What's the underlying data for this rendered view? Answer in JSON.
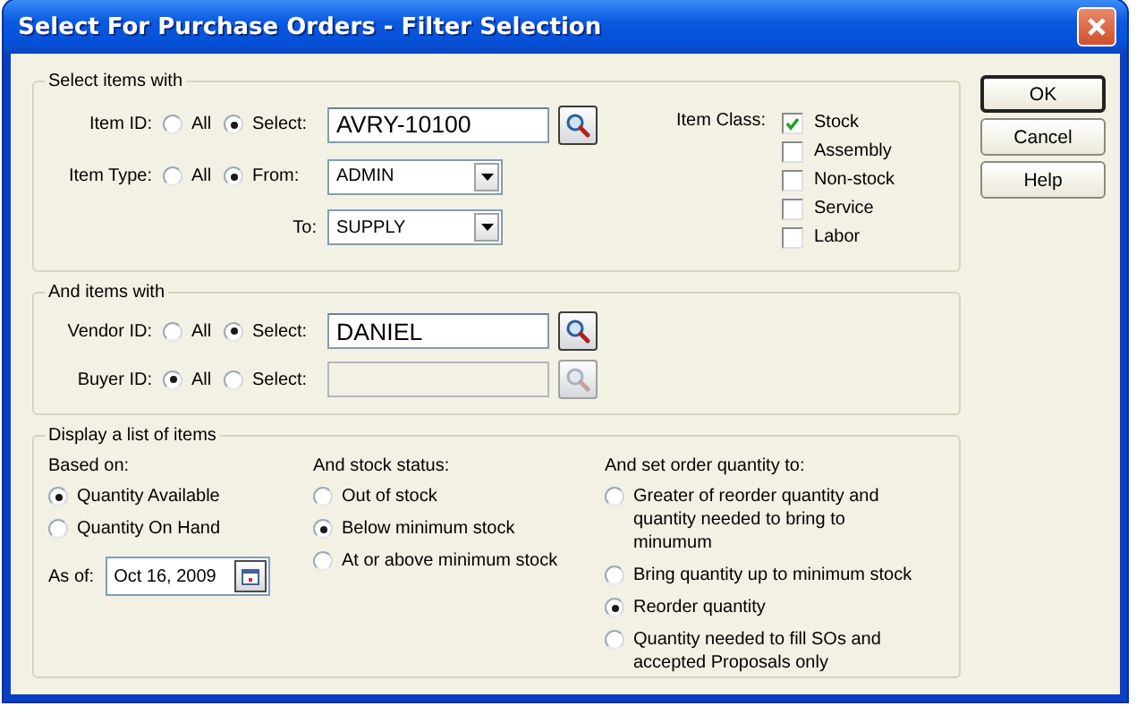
{
  "window": {
    "title": "Select For Purchase Orders - Filter Selection"
  },
  "item_group": {
    "title": "Select items with",
    "item_id": {
      "label": "Item ID:",
      "options": [
        {
          "label": "All",
          "selected": false
        },
        {
          "label": "Select:",
          "selected": true
        }
      ],
      "value": "AVRY-10100"
    },
    "item_type": {
      "label": "Item Type:",
      "options": [
        {
          "label": "All",
          "selected": false
        },
        {
          "label": "From:",
          "selected": true
        }
      ],
      "from_value": "ADMIN",
      "to_label": "To:",
      "to_value": "SUPPLY"
    },
    "item_class": {
      "label": "Item Class:",
      "options": [
        {
          "label": "Stock",
          "checked": true
        },
        {
          "label": "Assembly",
          "checked": false
        },
        {
          "label": "Non-stock",
          "checked": false
        },
        {
          "label": "Service",
          "checked": false
        },
        {
          "label": "Labor",
          "checked": false
        }
      ]
    }
  },
  "vendor_group": {
    "title": "And items with",
    "rows": [
      {
        "label": "Vendor ID:",
        "options": [
          {
            "label": "All",
            "selected": false
          },
          {
            "label": "Select:",
            "selected": true
          }
        ],
        "value": "DANIEL",
        "disabled": false
      },
      {
        "label": "Buyer ID:",
        "options": [
          {
            "label": "All",
            "selected": true
          },
          {
            "label": "Select:",
            "selected": false
          }
        ],
        "disabled": true
      }
    ]
  },
  "display_group": {
    "title": "Display a list of items",
    "based_on": {
      "label": "Based on:",
      "options": [
        {
          "label": "Quantity Available",
          "selected": true
        },
        {
          "label": "Quantity On Hand",
          "selected": false
        }
      ]
    },
    "as_of": {
      "label": "As of:",
      "value": "Oct 16, 2009"
    },
    "stock_status": {
      "label": "And stock status:",
      "options": [
        {
          "label": "Out of stock",
          "selected": false
        },
        {
          "label": "Below minimum stock",
          "selected": true
        },
        {
          "label": "At or above minimum stock",
          "selected": false
        }
      ]
    },
    "order_quantity": {
      "label": "And set order quantity to:",
      "options": [
        {
          "label": "Greater of reorder quantity and quantity needed to bring to minumum",
          "selected": false
        },
        {
          "label": "Bring quantity up to minimum stock",
          "selected": false
        },
        {
          "label": "Reorder quantity",
          "selected": true
        },
        {
          "label": "Quantity needed to fill SOs and accepted Proposals only",
          "selected": false
        }
      ]
    }
  },
  "buttons": [
    {
      "label": "OK",
      "default": true
    },
    {
      "label": "Cancel",
      "default": false
    },
    {
      "label": "Help",
      "default": false
    }
  ]
}
